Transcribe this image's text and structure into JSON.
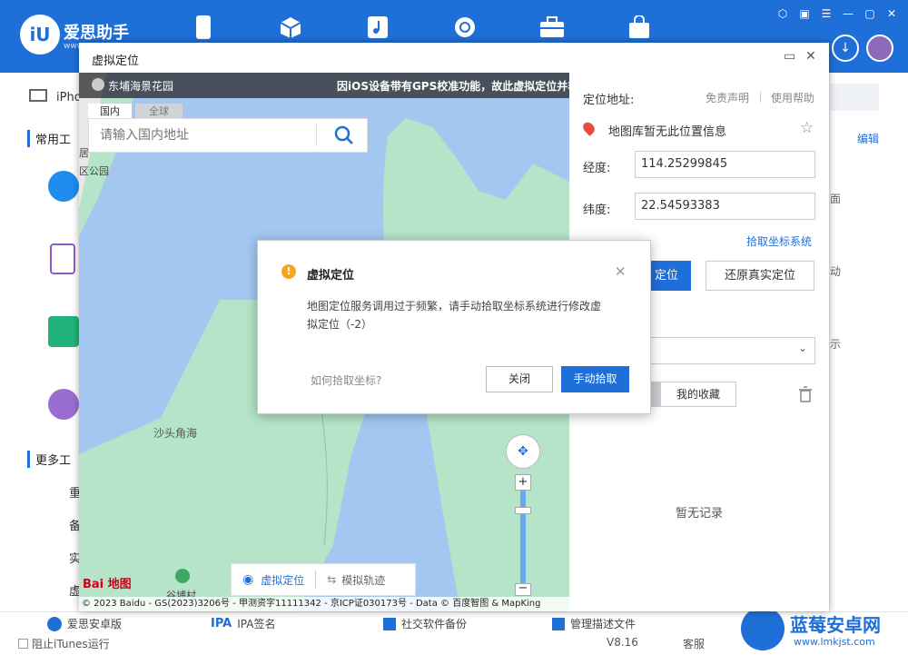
{
  "app": {
    "logo_mark": "iU",
    "title": "爱思助手",
    "subtitle": "www"
  },
  "topnav_icons": [
    "phone-icon",
    "cube-icon",
    "music-icon",
    "refresh-icon",
    "toolbox-icon",
    "bag-icon"
  ],
  "sidebar": {
    "device_label": "iPho",
    "section_common": "常用工",
    "section_more": "更多工",
    "small_items": [
      "重",
      "备",
      "实",
      "虚"
    ]
  },
  "right_strip": {
    "edit": "编辑",
    "item1": "面",
    "item2": "动",
    "item3": "示"
  },
  "bottom": {
    "items": [
      {
        "icon": "iu-icon",
        "label": "爱思安卓版"
      },
      {
        "icon": "ipa-icon",
        "label": "IPA签名"
      },
      {
        "icon": "backup-icon",
        "label": "社交软件备份"
      },
      {
        "icon": "profile-icon",
        "label": "管理描述文件"
      }
    ],
    "ipa_prefix": "IPA",
    "itunes_checkbox": "阻止iTunes运行",
    "version": "V8.16",
    "service": "客服"
  },
  "watermark": {
    "title": "蓝莓安卓网",
    "url": "www.lmkjst.com"
  },
  "dialog": {
    "title": "虚拟定位",
    "map": {
      "banner_place": "东埔海景花园",
      "banner_notice": "因iOS设备带有GPS校准功能，故此虚拟定位并非",
      "tab_domestic": "国内",
      "tab_global": "全球",
      "search_placeholder": "请输入国内地址",
      "label_park": "区公园",
      "label_home": "居",
      "label_bay": "沙头角海",
      "label_village": "谷埔村",
      "toolbar_virtual": "虚拟定位",
      "toolbar_track": "模拟轨迹",
      "copyright": "© 2023 Baidu - GS(2023)3206号 - 甲测资字11111342 - 京ICP证030173号 - Data © 百度智图 & MapKing",
      "baidu_logo": "Bai 地图"
    },
    "panel": {
      "location_label": "定位地址:",
      "disclaimer": "免责声明",
      "help": "使用帮助",
      "no_info": "地图库暂无此位置信息",
      "longitude_label": "经度:",
      "longitude_value": "114.25299845",
      "latitude_label": "纬度:",
      "latitude_value": "22.54593383",
      "pick_link": "拾取坐标系统",
      "modify_btn": "定位",
      "restore_btn": "还原真实定位",
      "favorites_tab": "我的收藏",
      "empty": "暂无记录"
    }
  },
  "modal": {
    "title": "虚拟定位",
    "message": "地图定位服务调用过于频繁，请手动拾取坐标系统进行修改虚拟定位（-2）",
    "help_link": "如何拾取坐标?",
    "close_btn": "关闭",
    "manual_btn": "手动拾取"
  },
  "colors": {
    "brand_blue": "#1f6fd9",
    "map_water": "#a3c7f1",
    "map_land": "#b6e4c8",
    "warning": "#f5a623"
  }
}
